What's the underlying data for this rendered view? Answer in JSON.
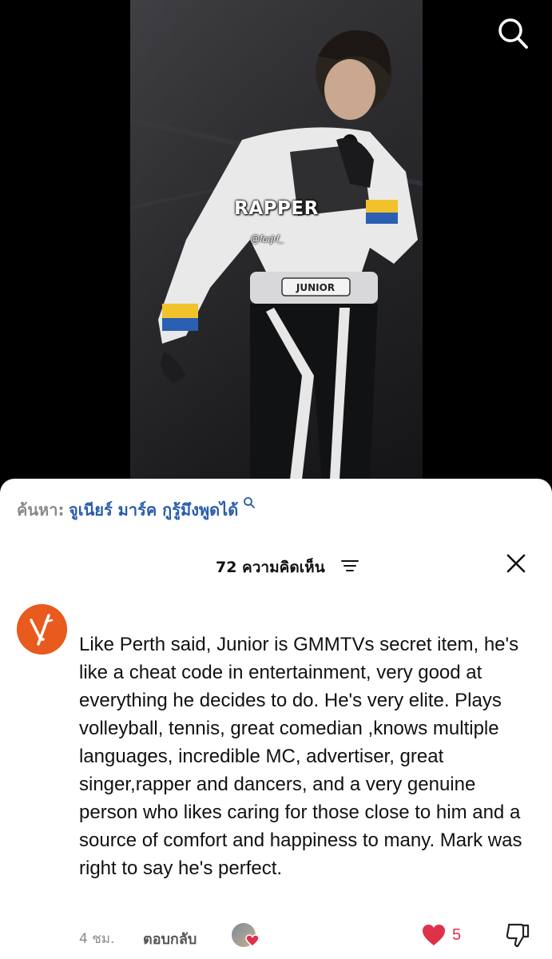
{
  "video": {
    "overlay_title": "RAPPER",
    "overlay_handle": "@forjrf_",
    "icons": {
      "search": "search-icon"
    }
  },
  "search_suggestion": {
    "prefix": "ค้นหา:",
    "query": "จูเนียร์ มาร์ค กูรู้มึงพูดได้"
  },
  "comments_header": {
    "count_label": "72 ความคิดเห็น",
    "icons": {
      "filter": "filter-icon",
      "close": "close-icon"
    }
  },
  "comment": {
    "text": "Like Perth said, Junior is GMMTVs secret item, he's like a cheat code in entertainment, very good at everything he decides to do. He's very elite. Plays volleyball, tennis, great comedian ,knows multiple languages, incredible MC, advertiser, great singer,rapper and dancers, and a very genuine person who likes caring for those close to him and a source of comfort and happiness to many. Mark was right to say he's perfect.",
    "timestamp": "4 ชม.",
    "reply_label": "ตอบกลับ",
    "like_count": "5",
    "liked": true
  },
  "colors": {
    "accent_like": "#e0314a",
    "link_blue": "#2a5caa",
    "avatar_orange": "#e85a1e"
  }
}
